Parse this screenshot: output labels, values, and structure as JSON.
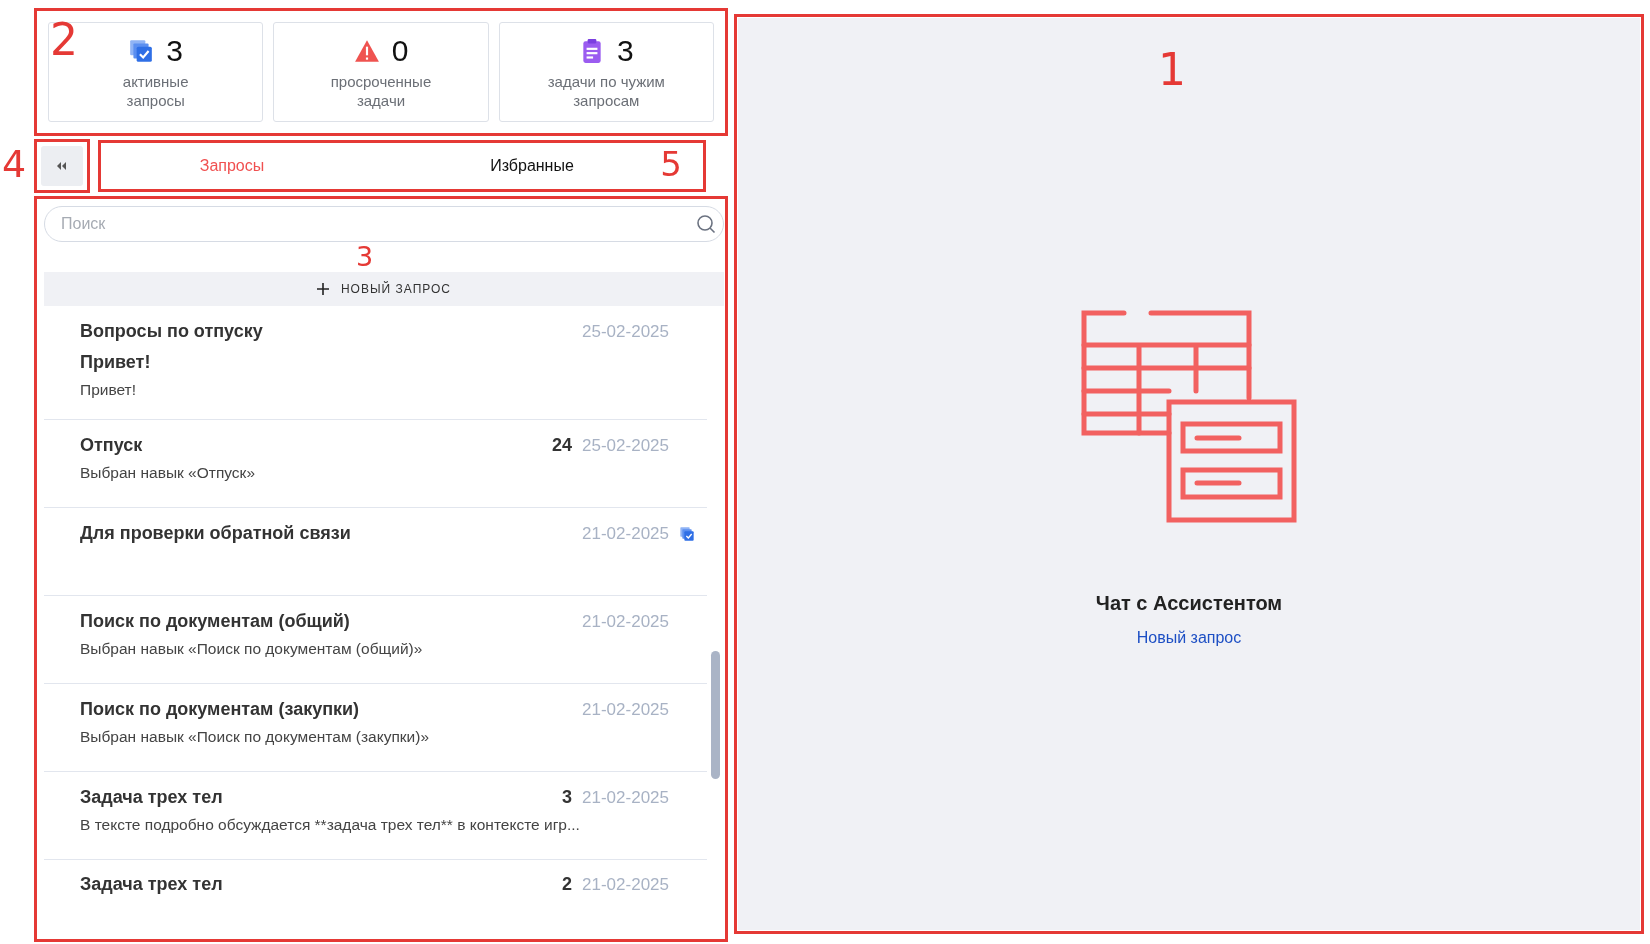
{
  "stats": {
    "annotation": "2",
    "cards": [
      {
        "kind": "active",
        "value": "3",
        "label": "активные запросы"
      },
      {
        "kind": "overdue",
        "value": "0",
        "label": "просроченные задачи"
      },
      {
        "kind": "foreign",
        "value": "3",
        "label": "задачи по чужим запросам"
      }
    ]
  },
  "collapse": {
    "annotation": "4"
  },
  "tabs": {
    "annotation": "5",
    "items": [
      {
        "label": "Запросы",
        "selected": true
      },
      {
        "label": "Избранные",
        "selected": false
      }
    ]
  },
  "list": {
    "annotation": "3",
    "search": {
      "placeholder": "Поиск"
    },
    "new_button": "НОВЫЙ ЗАПРОС",
    "rows": [
      {
        "title": "Вопросы по отпуску",
        "subtitle": "Привет!",
        "preview": "Привет!",
        "date": "25-02-2025",
        "task": false
      },
      {
        "title": "Отпуск",
        "preview": "Выбран навык «Отпуск»",
        "count": "24",
        "date": "25-02-2025",
        "task": false
      },
      {
        "title": "Для проверки обратной связи",
        "date": "21-02-2025",
        "task": true
      },
      {
        "title": "Поиск по документам (общий)",
        "preview": "Выбран навык «Поиск по документам (общий)»",
        "date": "21-02-2025",
        "task": false
      },
      {
        "title": "Поиск по документам (закупки)",
        "preview": "Выбран навык «Поиск по документам (закупки)»",
        "date": "21-02-2025",
        "task": false
      },
      {
        "title": "Задача трех тел",
        "preview": "В тексте подробно обсуждается **задача трех тел** в контексте игр...",
        "count": "3",
        "date": "21-02-2025",
        "task": false
      },
      {
        "title": "Задача трех тел",
        "count": "2",
        "date": "21-02-2025",
        "task": false
      }
    ]
  },
  "chat": {
    "annotation": "1",
    "title": "Чат с Ассистентом",
    "link": "Новый запрос"
  }
}
